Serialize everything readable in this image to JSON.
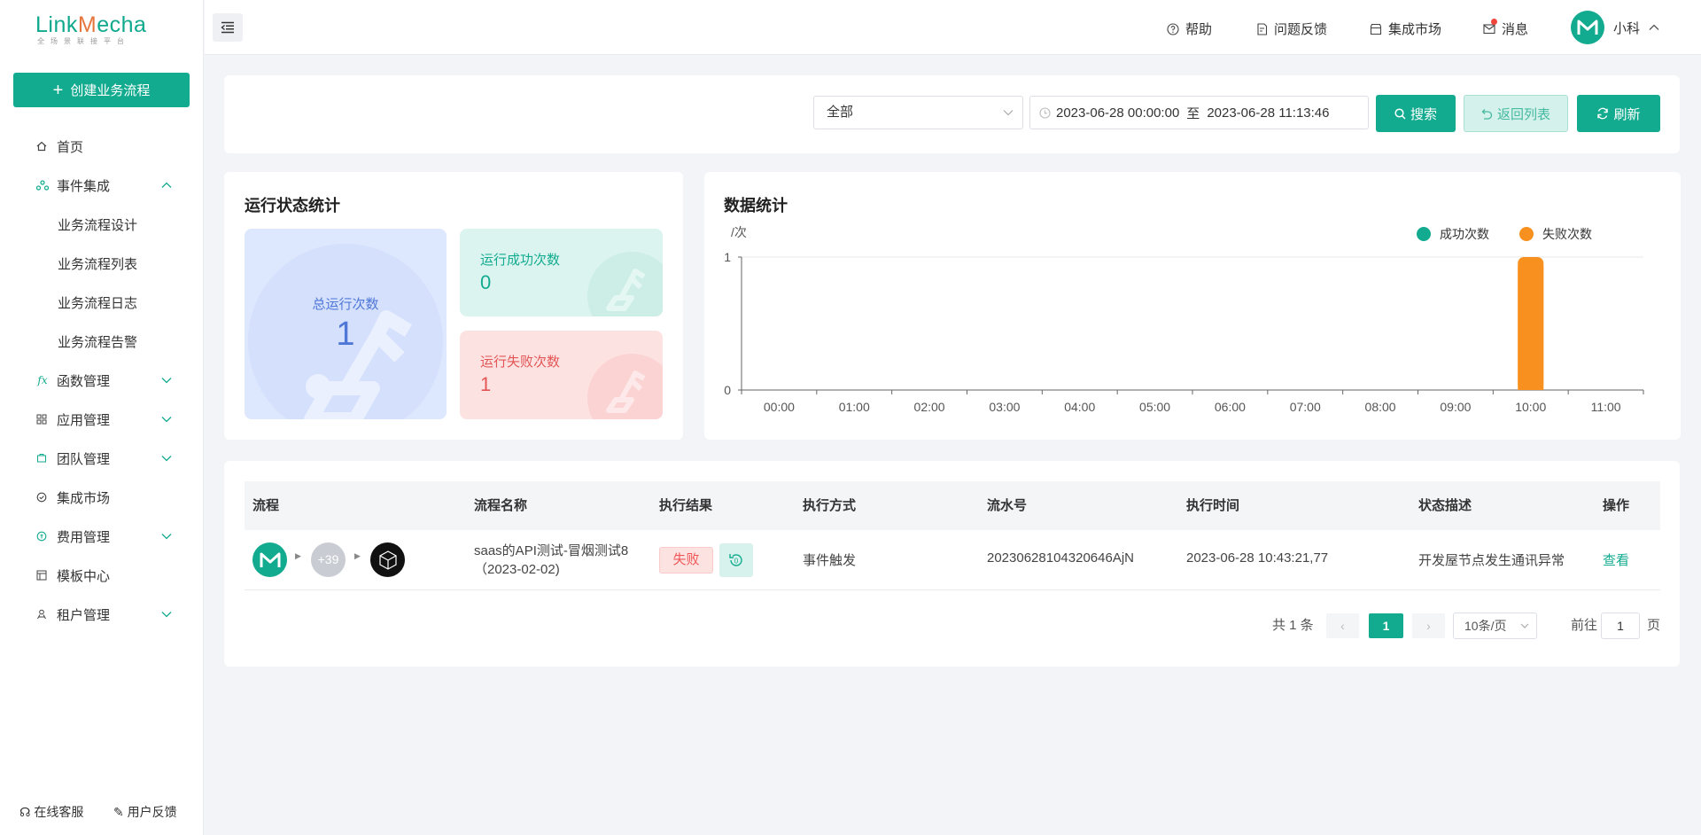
{
  "brand": {
    "name_a": "Link",
    "name_b": "M",
    "name_c": "echa",
    "subtitle": "全场景联接平台"
  },
  "sidebar": {
    "create_label": "创建业务流程",
    "items": [
      {
        "label": "首页",
        "icon": "home-icon"
      },
      {
        "label": "事件集成",
        "icon": "event-icon",
        "expanded": true
      },
      {
        "label": "业务流程设计",
        "sub": true
      },
      {
        "label": "业务流程列表",
        "sub": true
      },
      {
        "label": "业务流程日志",
        "sub": true
      },
      {
        "label": "业务流程告警",
        "sub": true
      },
      {
        "label": "函数管理",
        "icon": "function-icon"
      },
      {
        "label": "应用管理",
        "icon": "apps-icon"
      },
      {
        "label": "团队管理",
        "icon": "team-icon"
      },
      {
        "label": "集成市场",
        "icon": "market-icon"
      },
      {
        "label": "费用管理",
        "icon": "fee-icon"
      },
      {
        "label": "模板中心",
        "icon": "template-icon"
      },
      {
        "label": "租户管理",
        "icon": "tenant-icon"
      }
    ],
    "footer": {
      "service": "在线客服",
      "feedback": "用户反馈"
    }
  },
  "topbar": {
    "help": "帮助",
    "issue": "问题反馈",
    "market": "集成市场",
    "messages": "消息",
    "user": "小科"
  },
  "filter": {
    "status_value": "全部",
    "date_start": "2023-06-28 00:00:00",
    "date_sep": "至",
    "date_end": "2023-06-28 11:13:46",
    "search": "搜索",
    "back": "返回列表",
    "refresh": "刷新"
  },
  "stats": {
    "title": "运行状态统计",
    "total_label": "总运行次数",
    "total_value": "1",
    "success_label": "运行成功次数",
    "success_value": "0",
    "fail_label": "运行失败次数",
    "fail_value": "1"
  },
  "chart_data": {
    "type": "bar",
    "title": "数据统计",
    "ylabel": "/次",
    "ylim": [
      0,
      1
    ],
    "yticks": [
      "0",
      "1"
    ],
    "categories": [
      "00:00",
      "01:00",
      "02:00",
      "03:00",
      "04:00",
      "05:00",
      "06:00",
      "07:00",
      "08:00",
      "09:00",
      "10:00",
      "11:00"
    ],
    "series": [
      {
        "name": "成功次数",
        "color": "#12ab8f",
        "values": [
          0,
          0,
          0,
          0,
          0,
          0,
          0,
          0,
          0,
          0,
          0,
          0
        ]
      },
      {
        "name": "失败次数",
        "color": "#f7901e",
        "values": [
          0,
          0,
          0,
          0,
          0,
          0,
          0,
          0,
          0,
          0,
          1,
          0
        ]
      }
    ],
    "legend": "top-right",
    "grid": false
  },
  "table": {
    "columns": [
      "流程",
      "流程名称",
      "执行结果",
      "执行方式",
      "流水号",
      "执行时间",
      "状态描述",
      "操作"
    ],
    "rows": [
      {
        "flow_count": "+39",
        "name_line1": "saas的API测试-冒烟测试8",
        "name_line2": "（2023-02-02)",
        "result": "失败",
        "mode": "事件触发",
        "serial": "20230628104320646AjN",
        "time": "2023-06-28 10:43:21,77",
        "status": "开发屋节点发生通讯异常",
        "action": "查看"
      }
    ]
  },
  "pagination": {
    "total": "共 1 条",
    "current": "1",
    "page_size": "10条/页",
    "goto_prefix": "前往",
    "goto_value": "1",
    "goto_suffix": "页"
  }
}
